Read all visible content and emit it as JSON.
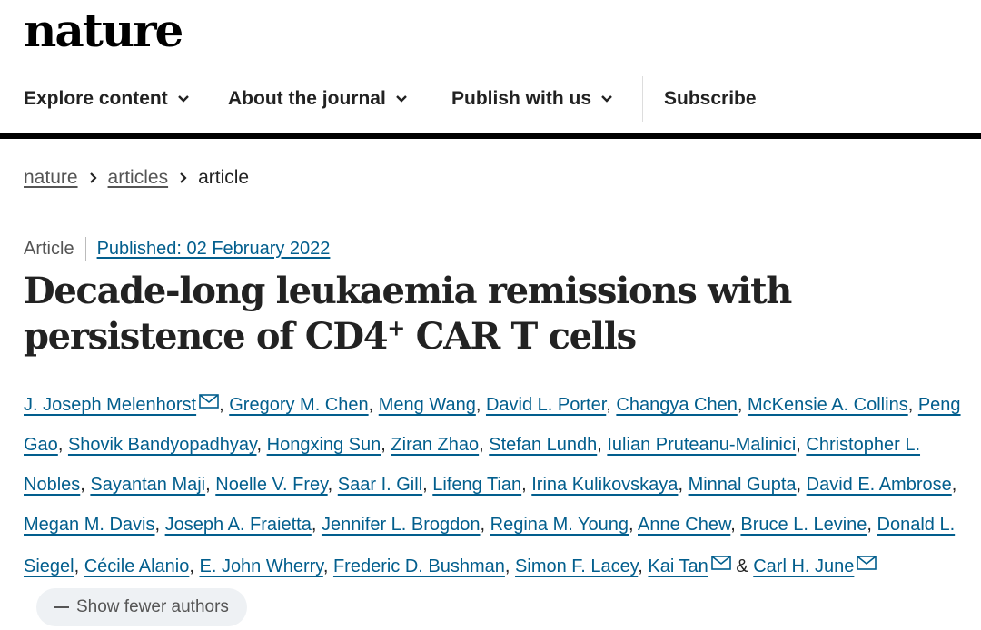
{
  "brand": {
    "logo": "nature"
  },
  "nav": {
    "items": [
      {
        "label": "Explore content",
        "dropdown": true
      },
      {
        "label": "About the journal",
        "dropdown": true
      },
      {
        "label": "Publish with us",
        "dropdown": true
      }
    ],
    "subscribe": "Subscribe"
  },
  "breadcrumb": {
    "items": [
      "nature",
      "articles"
    ],
    "current": "article"
  },
  "article": {
    "type": "Article",
    "published": "Published: 02 February 2022",
    "title_part1": "Decade-long leukaemia remissions with persistence of CD4",
    "title_sup": "+",
    "title_part2": " CAR T cells"
  },
  "authors": [
    {
      "name": "J. Joseph Melenhorst",
      "email": true
    },
    {
      "name": "Gregory M. Chen"
    },
    {
      "name": "Meng Wang"
    },
    {
      "name": "David L. Porter"
    },
    {
      "name": "Changya Chen"
    },
    {
      "name": "McKensie A. Collins"
    },
    {
      "name": "Peng Gao"
    },
    {
      "name": "Shovik Bandyopadhyay"
    },
    {
      "name": "Hongxing Sun"
    },
    {
      "name": "Ziran Zhao"
    },
    {
      "name": "Stefan Lundh"
    },
    {
      "name": "Iulian Pruteanu-Malinici"
    },
    {
      "name": "Christopher L. Nobles"
    },
    {
      "name": "Sayantan Maji"
    },
    {
      "name": "Noelle V. Frey"
    },
    {
      "name": "Saar I. Gill"
    },
    {
      "name": "Lifeng Tian"
    },
    {
      "name": "Irina Kulikovskaya"
    },
    {
      "name": "Minnal Gupta"
    },
    {
      "name": "David E. Ambrose"
    },
    {
      "name": "Megan M. Davis"
    },
    {
      "name": "Joseph A. Fraietta"
    },
    {
      "name": "Jennifer L. Brogdon"
    },
    {
      "name": "Regina M. Young"
    },
    {
      "name": "Anne Chew"
    },
    {
      "name": "Bruce L. Levine"
    },
    {
      "name": "Donald L. Siegel"
    },
    {
      "name": "Cécile Alanio"
    },
    {
      "name": "E. John Wherry"
    },
    {
      "name": "Frederic D. Bushman"
    },
    {
      "name": "Simon F. Lacey"
    },
    {
      "name": "Kai Tan",
      "email": true
    },
    {
      "name": "Carl H. June",
      "email": true
    }
  ],
  "authors_ui": {
    "separator": ", ",
    "last_joiner": " & ",
    "show_fewer": "Show fewer authors"
  },
  "colors": {
    "link": "#025e8d",
    "text": "#222222",
    "button_bg": "#eef1f4"
  }
}
